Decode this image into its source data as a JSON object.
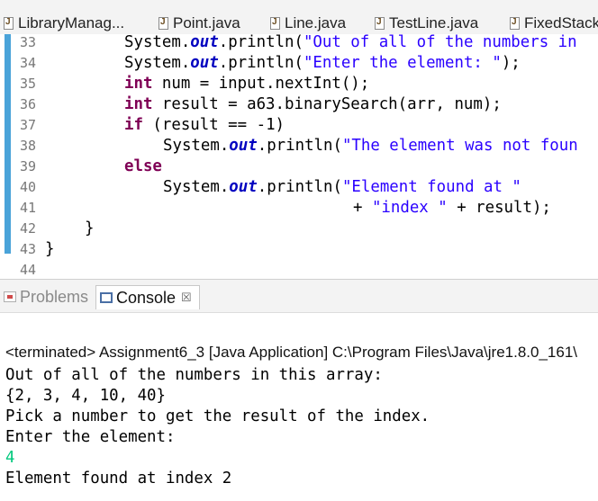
{
  "editor_tabs": [
    {
      "label": "LibraryManag...",
      "active": false
    },
    {
      "label": "Point.java",
      "active": false
    },
    {
      "label": "Line.java",
      "active": false
    },
    {
      "label": "TestLine.java",
      "active": false
    },
    {
      "label": "FixedStack",
      "active": false
    }
  ],
  "line_numbers": [
    "33",
    "34",
    "35",
    "36",
    "37",
    "38",
    "39",
    "40",
    "41",
    "42",
    "43",
    "44"
  ],
  "code": {
    "l33": {
      "a": "System.",
      "b": "out",
      "c": ".println(",
      "d": "\"Out of all of the numbers in"
    },
    "l34": {
      "a": "System.",
      "b": "out",
      "c": ".println(",
      "d": "\"Enter the element: \"",
      "e": ");"
    },
    "l35": {
      "kw": "int",
      "rest": " num = input.nextInt();"
    },
    "l36": {
      "kw": "int",
      "rest": " result = a63.binarySearch(arr, num);"
    },
    "l37": {
      "kw": "if",
      "rest": " (result == -1)"
    },
    "l38": {
      "a": "System.",
      "b": "out",
      "c": ".println(",
      "d": "\"The element was not foun"
    },
    "l39": {
      "kw": "else"
    },
    "l40": {
      "a": "System.",
      "b": "out",
      "c": ".println(",
      "d": "\"Element found at \""
    },
    "l41": {
      "a": "+ ",
      "d": "\"index \"",
      "e": " + result);"
    },
    "l42": {
      "text": "}"
    },
    "l43": {
      "text": "}"
    }
  },
  "panel_tabs": {
    "problems": "Problems",
    "console": "Console",
    "close_symbol": "☒"
  },
  "status_line": "<terminated> Assignment6_3 [Java Application] C:\\Program Files\\Java\\jre1.8.0_161\\",
  "console_output": [
    "Out of all of the numbers in this array:",
    "{2, 3, 4, 10, 40}",
    "Pick a number to get the result of the index.",
    "Enter the element:",
    "4",
    "Element found at index 2"
  ],
  "colors": {
    "keyword": "#7f0055",
    "field": "#0000c0",
    "string": "#2a00ff",
    "console_input": "#00c87d",
    "ruler": "#4aa3d9"
  }
}
